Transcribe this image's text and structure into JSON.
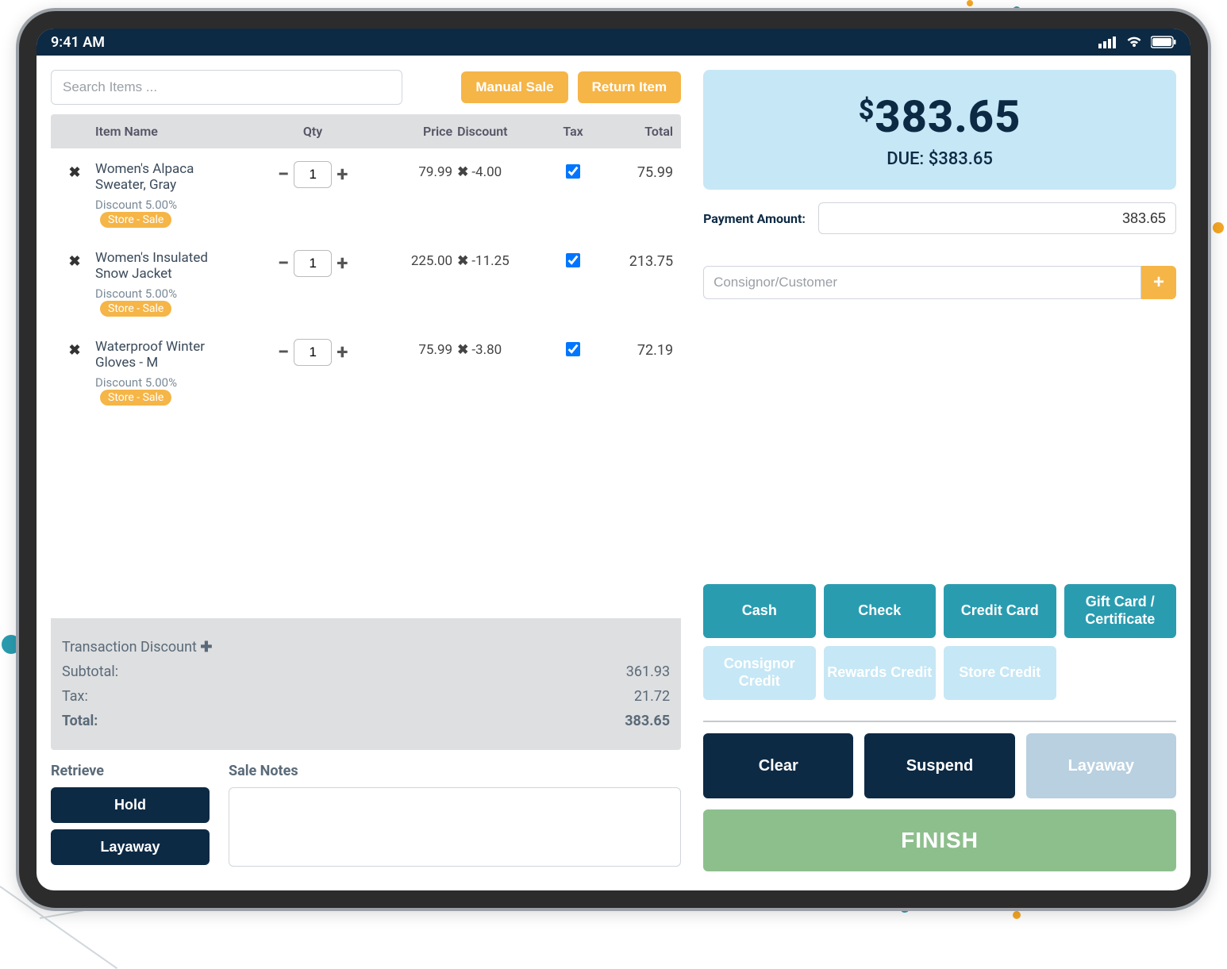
{
  "statusbar": {
    "time": "9:41 AM"
  },
  "search": {
    "placeholder": "Search Items ..."
  },
  "buttons": {
    "manual_sale": "Manual Sale",
    "return_item": "Return Item",
    "hold": "Hold",
    "layaway": "Layaway",
    "clear": "Clear",
    "suspend": "Suspend",
    "layaway_action": "Layaway",
    "finish": "FINISH",
    "add_customer": "+"
  },
  "headers": {
    "item_name": "Item Name",
    "qty": "Qty",
    "price": "Price",
    "discount": "Discount",
    "tax": "Tax",
    "total": "Total"
  },
  "items": [
    {
      "name": "Women's Alpaca Sweater, Gray",
      "discount_text": "Discount 5.00%",
      "badge": "Store - Sale",
      "qty": "1",
      "price": "79.99",
      "discount": "-4.00",
      "tax": true,
      "total": "75.99"
    },
    {
      "name": "Women's Insulated Snow Jacket",
      "discount_text": "Discount 5.00%",
      "badge": "Store - Sale",
      "qty": "1",
      "price": "225.00",
      "discount": "-11.25",
      "tax": true,
      "total": "213.75"
    },
    {
      "name": "Waterproof Winter Gloves - M",
      "discount_text": "Discount 5.00%",
      "badge": "Store - Sale",
      "qty": "1",
      "price": "75.99",
      "discount": "-3.80",
      "tax": true,
      "total": "72.19"
    }
  ],
  "summary": {
    "transaction_discount_label": "Transaction Discount",
    "subtotal_label": "Subtotal:",
    "subtotal": "361.93",
    "tax_label": "Tax:",
    "tax": "21.72",
    "total_label": "Total:",
    "total": "383.65"
  },
  "retrieve_label": "Retrieve",
  "notes_label": "Sale Notes",
  "due": {
    "amount": "383.65",
    "due_line": "DUE: $383.65"
  },
  "payment": {
    "label": "Payment Amount:",
    "value": "383.65"
  },
  "consignor": {
    "placeholder": "Consignor/Customer"
  },
  "payment_methods": {
    "cash": "Cash",
    "check": "Check",
    "credit_card": "Credit Card",
    "gift_card": "Gift Card / Certificate",
    "consignor_credit": "Consignor Credit",
    "rewards_credit": "Rewards Credit",
    "store_credit": "Store Credit"
  }
}
